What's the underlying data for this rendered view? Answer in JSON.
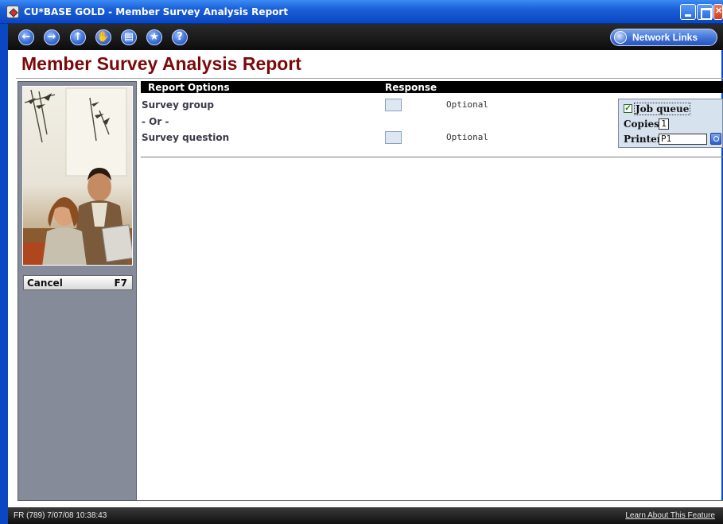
{
  "window": {
    "title": "CU*BASE GOLD - Member Survey Analysis Report"
  },
  "toolbar": {
    "nav_buttons": [
      {
        "name": "back-icon",
        "glyph": "←"
      },
      {
        "name": "forward-icon",
        "glyph": "→"
      },
      {
        "name": "up-icon",
        "glyph": "↑"
      },
      {
        "name": "hand-icon",
        "glyph": "✋"
      },
      {
        "name": "print-icon",
        "glyph": "▤"
      },
      {
        "name": "favorites-icon",
        "glyph": "★"
      },
      {
        "name": "help-icon",
        "glyph": "?"
      }
    ],
    "network_links_label": "Network Links"
  },
  "page": {
    "title": "Member Survey Analysis Report"
  },
  "options": {
    "header_options": "Report Options",
    "header_response": "Response",
    "rows": [
      {
        "label": "Survey group",
        "note": "Optional"
      },
      {
        "label": "- Or -"
      },
      {
        "label": "Survey question",
        "note": "Optional"
      }
    ]
  },
  "job_queue": {
    "label": "Job queue",
    "checked": true,
    "copies_label": "Copies",
    "copies_value": "1",
    "printer_label": "Printer",
    "printer_value": "P1"
  },
  "side_panel": {
    "cancel_label": "Cancel",
    "cancel_key": "F7"
  },
  "status_bar": {
    "info": "FR (789) 7/07/08 10:38:43",
    "learn_link": "Learn About This Feature"
  },
  "colors": {
    "title_red": "#7a0a0a",
    "titlebar_blue": "#0a47c2",
    "side_panel_gray": "#868b99",
    "field_blue": "#dce7f3"
  }
}
